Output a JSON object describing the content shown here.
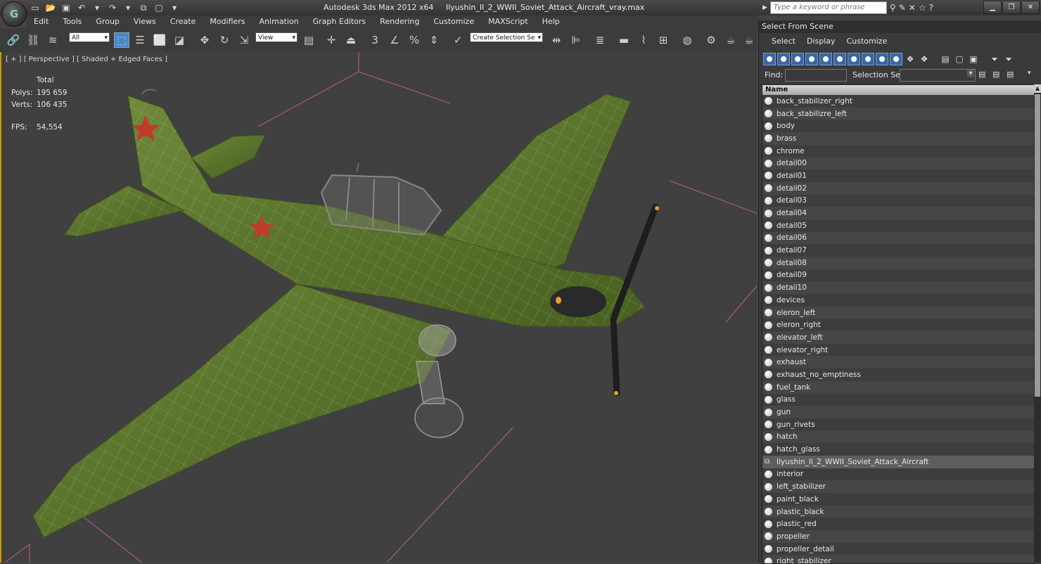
{
  "app": {
    "title": "Autodesk 3ds Max  2012 x64",
    "file_name": "Ilyushin_Il_2_WWII_Soviet_Attack_Aircraft_vray.max",
    "logo": "G"
  },
  "search": {
    "placeholder": "Type a keyword or phrase"
  },
  "menu": [
    "Edit",
    "Tools",
    "Group",
    "Views",
    "Create",
    "Modifiers",
    "Animation",
    "Graph Editors",
    "Rendering",
    "Customize",
    "MAXScript",
    "Help"
  ],
  "toolbar": {
    "filter_value": "All",
    "coord_value": "View",
    "snap_label": "3",
    "percent_label": "%",
    "named_selection_placeholder": "Create Selection Se"
  },
  "viewport": {
    "label": "[ + ] [ Perspective ] [ Shaded + Edged Faces ]",
    "stats": {
      "total_label": "Total",
      "polys_label": "Polys:",
      "polys_value": "195 659",
      "verts_label": "Verts:",
      "verts_value": "106 435",
      "fps_label": "FPS:",
      "fps_value": "54,554"
    }
  },
  "panel": {
    "title": "Select From Scene",
    "menu": [
      "Select",
      "Display",
      "Customize"
    ],
    "find_label": "Find:",
    "selection_set_label": "Selection Set:",
    "list_header": "Name",
    "items": [
      "back_stabilizer_right",
      "back_stabilizre_left",
      "body",
      "brass",
      "chrome",
      "detail00",
      "detail01",
      "detail02",
      "detail03",
      "detail04",
      "detail05",
      "detail06",
      "detail07",
      "detail08",
      "detail09",
      "detail10",
      "devices",
      "eleron_left",
      "eleron_right",
      "elevator_left",
      "elevator_right",
      "exhaust",
      "exhaust_no_emptiness",
      "fuel_tank",
      "glass",
      "gun",
      "gun_rivets",
      "hatch",
      "hatch_glass",
      "Ilyushin_Il_2_WWII_Soviet_Attack_Aircraft",
      "interior",
      "left_stabilizer",
      "paint_black",
      "plastic_black",
      "plastic_red",
      "propeller",
      "propeller_detail",
      "right_stabilizer"
    ],
    "selected_item": "Ilyushin_Il_2_WWII_Soviet_Attack_Aircraft"
  },
  "colors": {
    "accent": "#c99a00",
    "selection_blue": "#4a86c8",
    "stats_text": "#e6c400",
    "aircraft_green": "#5c7a2e",
    "grid_red": "#c0607a"
  }
}
